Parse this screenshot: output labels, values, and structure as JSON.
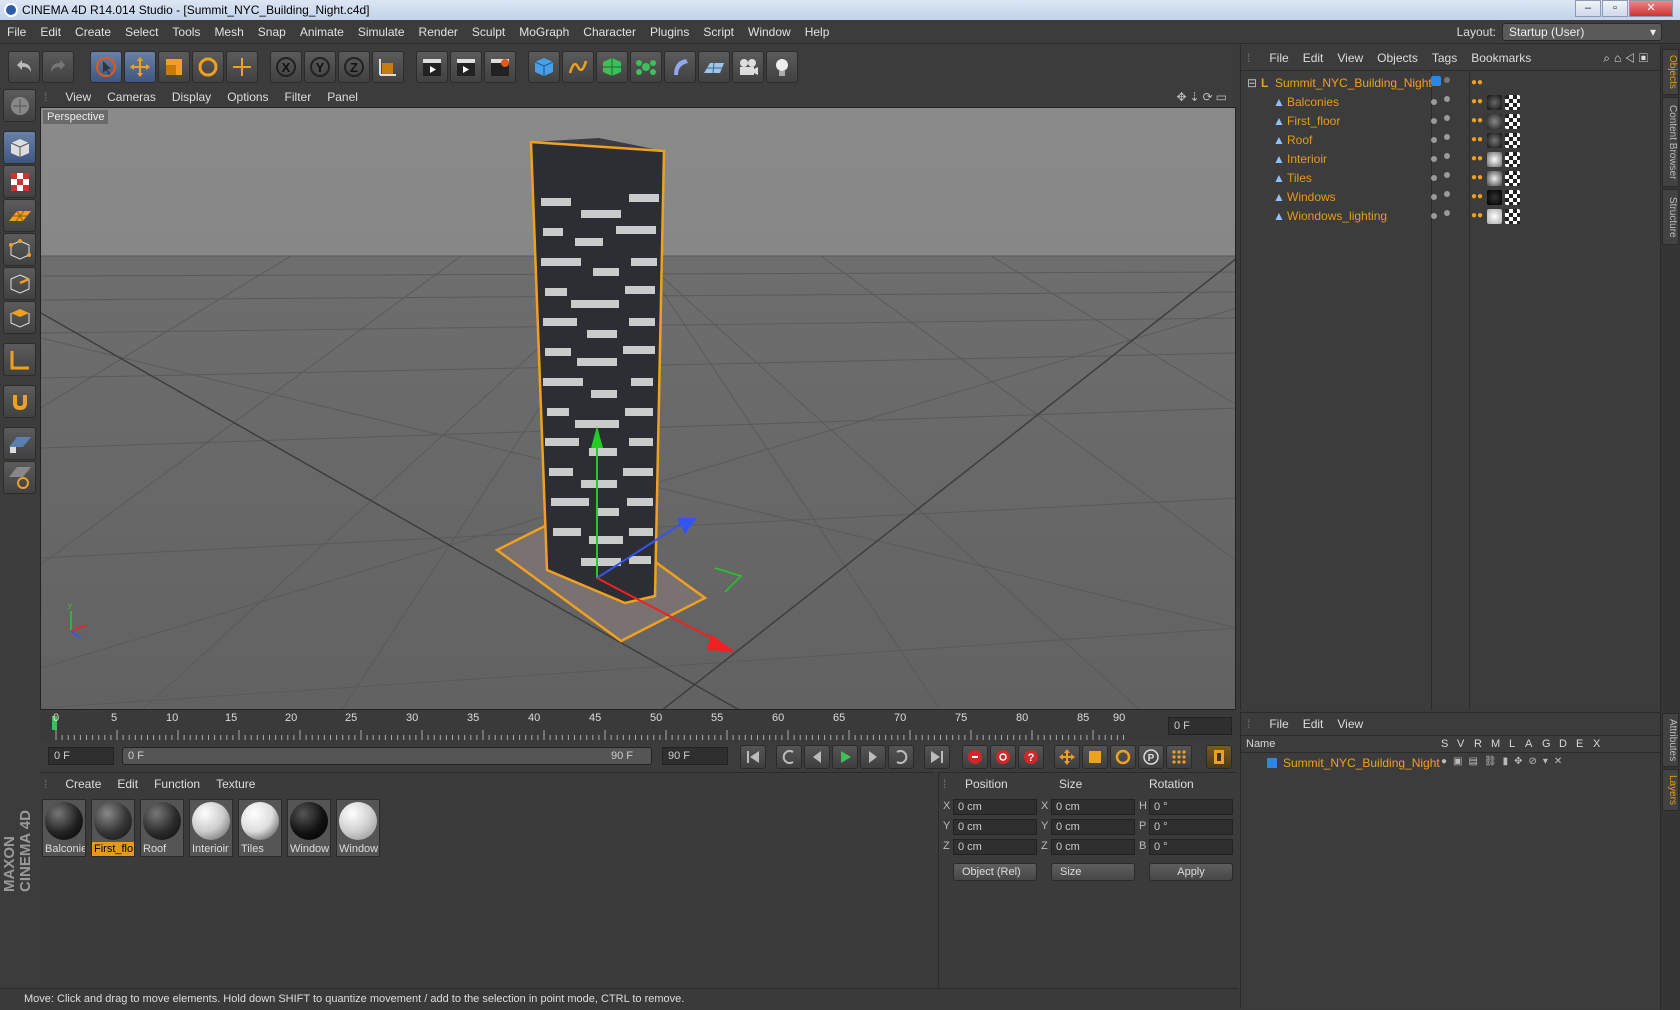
{
  "window": {
    "title": "CINEMA 4D R14.014 Studio - [Summit_NYC_Building_Night.c4d]"
  },
  "menu": [
    "File",
    "Edit",
    "Create",
    "Select",
    "Tools",
    "Mesh",
    "Snap",
    "Animate",
    "Simulate",
    "Render",
    "Sculpt",
    "MoGraph",
    "Character",
    "Plugins",
    "Script",
    "Window",
    "Help"
  ],
  "layout": {
    "label": "Layout:",
    "value": "Startup (User)"
  },
  "viewport": {
    "menu": [
      "View",
      "Cameras",
      "Display",
      "Options",
      "Filter",
      "Panel"
    ],
    "label": "Perspective"
  },
  "timeline": {
    "ticks": [
      "0",
      "5",
      "10",
      "15",
      "20",
      "25",
      "30",
      "35",
      "40",
      "45",
      "50",
      "55",
      "60",
      "65",
      "70",
      "75",
      "80",
      "85",
      "90"
    ],
    "current_frame": "0 F"
  },
  "transport": {
    "start": "0 F",
    "range_start": "0 F",
    "range_end": "90 F",
    "end": "90 F"
  },
  "materials": {
    "menu": [
      "Create",
      "Edit",
      "Function",
      "Texture"
    ],
    "items": [
      {
        "name": "Balconie",
        "color": "#222222"
      },
      {
        "name": "First_flo",
        "color": "#3a3a3a"
      },
      {
        "name": "Roof",
        "color": "#2a2a2a"
      },
      {
        "name": "Interioir",
        "color": "#eeeeee"
      },
      {
        "name": "Tiles",
        "color": "#dddddd"
      },
      {
        "name": "Window",
        "color": "#111111"
      },
      {
        "name": "Window",
        "color": "#cfcfcf"
      }
    ]
  },
  "coords": {
    "headers": [
      "Position",
      "Size",
      "Rotation"
    ],
    "rows": [
      {
        "axis": "X",
        "pos": "0 cm",
        "saxis": "X",
        "size": "0 cm",
        "raxis": "H",
        "rot": "0 °"
      },
      {
        "axis": "Y",
        "pos": "0 cm",
        "saxis": "Y",
        "size": "0 cm",
        "raxis": "P",
        "rot": "0 °"
      },
      {
        "axis": "Z",
        "pos": "0 cm",
        "saxis": "Z",
        "size": "0 cm",
        "raxis": "B",
        "rot": "0 °"
      }
    ],
    "mode": "Object (Rel)",
    "size_mode": "Size",
    "apply": "Apply"
  },
  "objects": {
    "menu": [
      "File",
      "Edit",
      "View",
      "Objects",
      "Tags",
      "Bookmarks"
    ],
    "root": "Summit_NYC_Building_Night",
    "children": [
      "Balconies",
      "First_floor",
      "Roof",
      "Interioir",
      "Tiles",
      "Windows",
      "Wiondows_lighting"
    ]
  },
  "layers": {
    "menu": [
      "File",
      "Edit",
      "View"
    ],
    "columns": [
      "Name",
      "S",
      "V",
      "R",
      "M",
      "L",
      "A",
      "G",
      "D",
      "E",
      "X"
    ],
    "rows": [
      "Summit_NYC_Building_Night"
    ]
  },
  "side_tabs": [
    "Objects",
    "Content Browser",
    "Structure",
    "Attributes",
    "Layers"
  ],
  "brand": "MAXON CINEMA 4D",
  "status": "Move: Click and drag to move elements. Hold down SHIFT to quantize movement / add to the selection in point mode, CTRL to remove."
}
